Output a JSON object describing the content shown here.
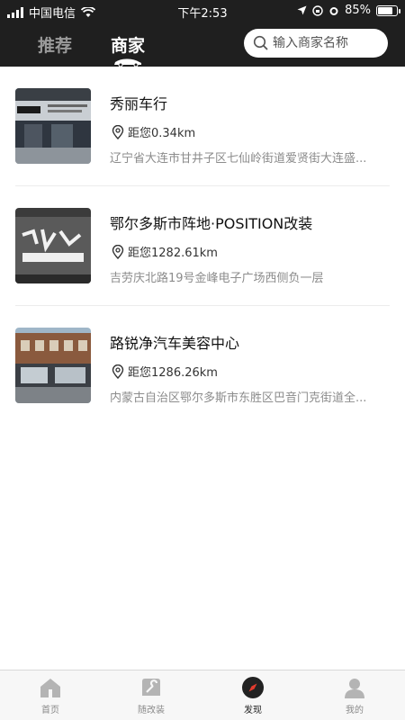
{
  "status_bar": {
    "carrier": "中国电信",
    "time": "下午2:53",
    "battery": "85%",
    "battery_level": 0.85
  },
  "header": {
    "tabs": [
      {
        "label": "推荐",
        "active": false
      },
      {
        "label": "商家",
        "active": true
      }
    ],
    "search": {
      "placeholder": "输入商家名称"
    }
  },
  "shops": [
    {
      "name": "秀丽车行",
      "distance": "距您0.34km",
      "address": "辽宁省大连市甘井子区七仙岭街道爱贤街大连盛..."
    },
    {
      "name": "鄂尔多斯市阵地·POSITION改装",
      "distance": "距您1282.61km",
      "address": "吉劳庆北路19号金峰电子广场西侧负一层"
    },
    {
      "name": "路锐净汽车美容中心",
      "distance": "距您1286.26km",
      "address": "内蒙古自治区鄂尔多斯市东胜区巴音门克街道全..."
    }
  ],
  "bottom_nav": [
    {
      "label": "首页",
      "icon": "home-icon",
      "active": false
    },
    {
      "label": "随改装",
      "icon": "wrench-icon",
      "active": false
    },
    {
      "label": "发现",
      "icon": "compass-icon",
      "active": true
    },
    {
      "label": "我的",
      "icon": "user-icon",
      "active": false
    }
  ],
  "colors": {
    "header_bg": "#1f1f1f",
    "accent_red": "#e23b2e"
  }
}
